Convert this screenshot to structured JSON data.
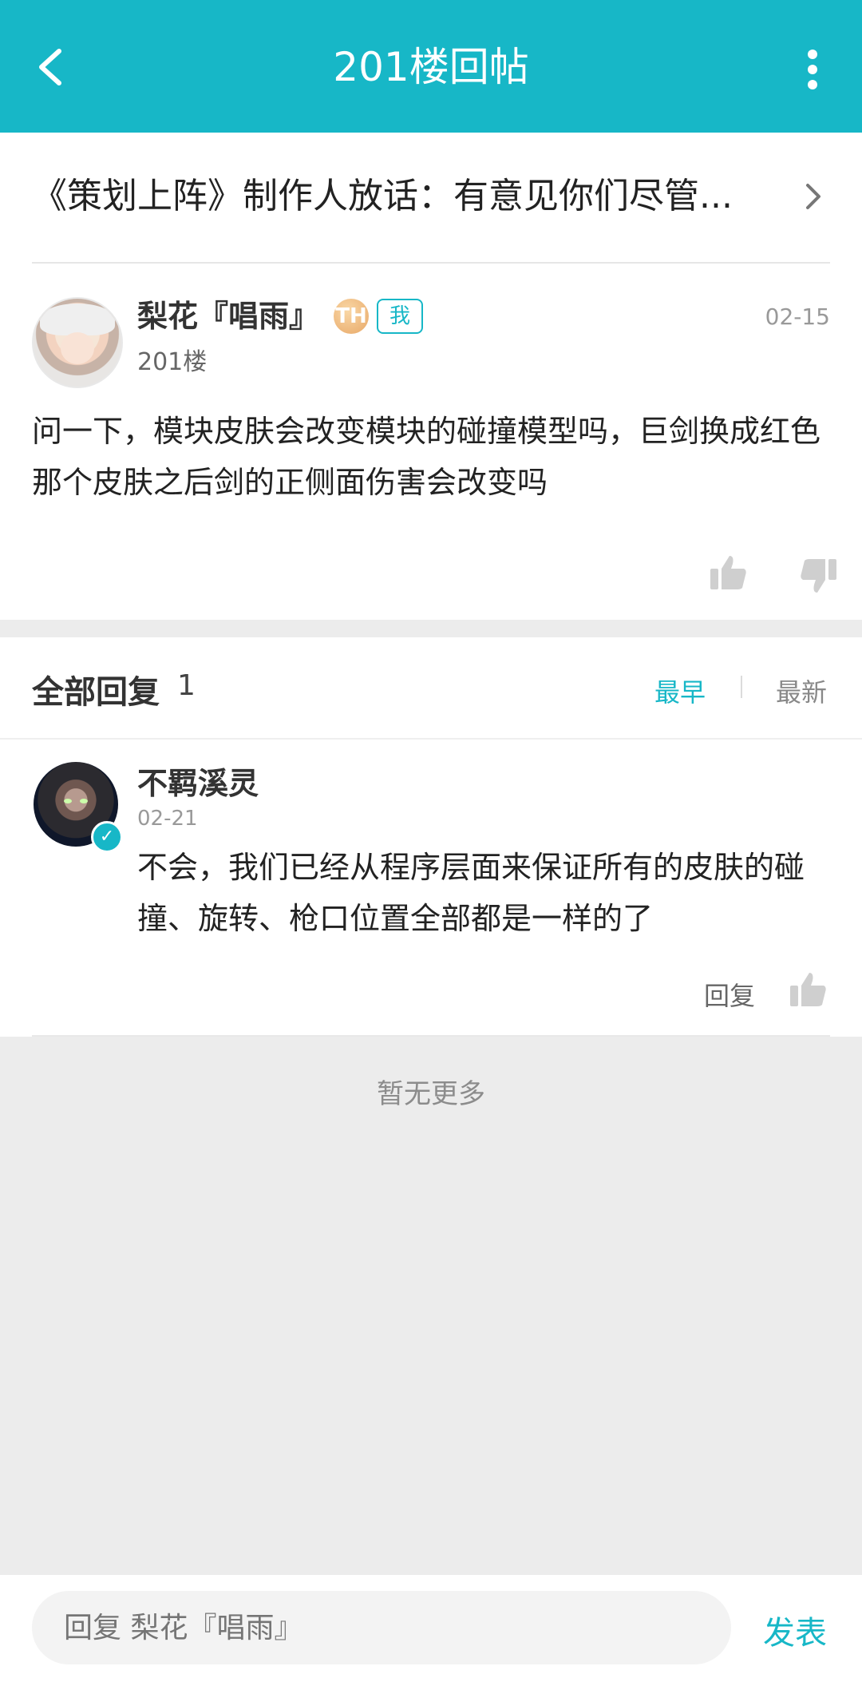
{
  "header": {
    "title": "201楼回帖",
    "back_icon": "back-arrow-icon",
    "more_icon": "more-vert-icon"
  },
  "thread": {
    "title": "《策划上阵》制作人放话：有意见你们尽管...",
    "arrow_icon": "chevron-right-icon"
  },
  "post": {
    "author": "梨花『唱雨』",
    "badge_coin": "TH",
    "badge_me": "我",
    "date": "02-15",
    "floor": "201楼",
    "content": "问一下，模块皮肤会改变模块的碰撞模型吗，巨剑换成红色那个皮肤之后剑的正侧面伤害会改变吗"
  },
  "replies": {
    "title": "全部回复",
    "count": "1",
    "sort_earliest": "最早",
    "sort_latest": "最新",
    "items": [
      {
        "author": "不羁溪灵",
        "date": "02-21",
        "content": "不会，我们已经从程序层面来保证所有的皮肤的碰撞、旋转、枪口位置全部都是一样的了",
        "action_reply": "回复"
      }
    ]
  },
  "footer": {
    "no_more": "暂无更多",
    "input_placeholder": "回复 梨花『唱雨』",
    "send_label": "发表"
  },
  "colors": {
    "accent": "#17b7c7"
  }
}
